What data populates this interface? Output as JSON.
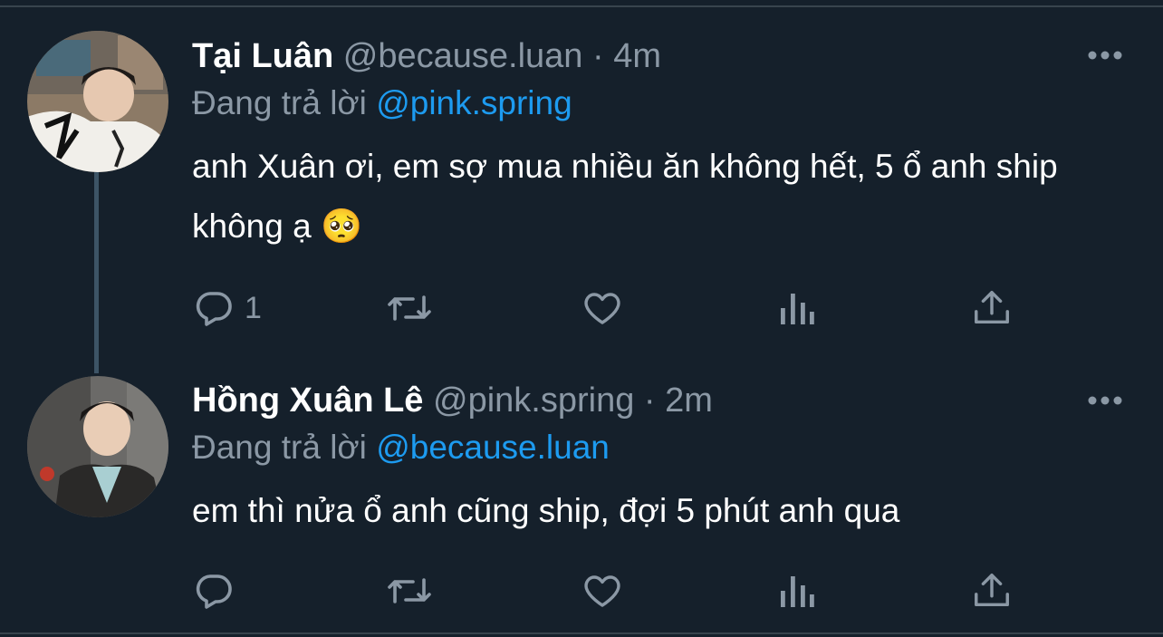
{
  "tweets": [
    {
      "display_name": "Tại Luân",
      "handle": "@because.luan",
      "separator": "·",
      "time": "4m",
      "replying_prefix": "Đang trả lời",
      "replying_to": "@pink.spring",
      "text": "anh Xuân ơi, em sợ mua nhiều ăn không hết, 5 ổ anh ship không ạ 🥺",
      "reply_count": "1",
      "avatar_icon": "profile-photo"
    },
    {
      "display_name": "Hồng Xuân Lê",
      "handle": "@pink.spring",
      "separator": "·",
      "time": "2m",
      "replying_prefix": "Đang trả lời",
      "replying_to": "@because.luan",
      "text": "em thì nửa ổ anh cũng ship, đợi 5 phút anh qua",
      "reply_count": "",
      "avatar_icon": "profile-photo"
    }
  ],
  "icons": {
    "reply": "reply-icon",
    "retweet": "retweet-icon",
    "like": "like-icon",
    "analytics": "analytics-icon",
    "share": "share-icon",
    "more": "more-icon"
  },
  "colors": {
    "background": "#15202b",
    "text": "#ffffff",
    "secondary_text": "#8b98a5",
    "link": "#1d9bf0",
    "thread_line": "#3d5466"
  }
}
